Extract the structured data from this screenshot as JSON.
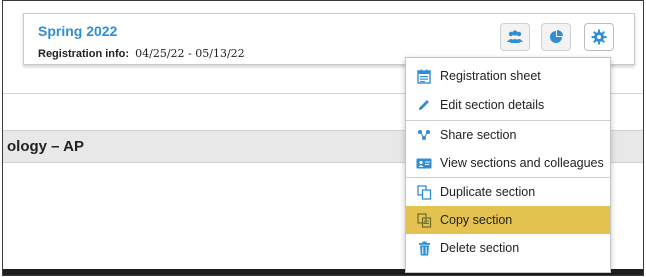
{
  "section": {
    "term": "Spring 2022",
    "registration_label": "Registration info:",
    "registration_dates": "04/25/22 - 05/13/22"
  },
  "toolbar": {
    "buttons": [
      {
        "icon": "people-icon"
      },
      {
        "icon": "pie-chart-icon"
      },
      {
        "icon": "gear-icon",
        "state": "active"
      }
    ]
  },
  "course": {
    "title": "ology – AP"
  },
  "menu": {
    "items": [
      {
        "label": "Registration sheet",
        "icon": "registration-sheet-icon"
      },
      {
        "label": "Edit section details",
        "icon": "pencil-icon"
      },
      {
        "label": "Share section",
        "icon": "share-icon"
      },
      {
        "label": "View sections and colleagues",
        "icon": "id-card-icon"
      },
      {
        "label": "Duplicate section",
        "icon": "duplicate-icon"
      },
      {
        "label": "Copy section",
        "icon": "copy-icon",
        "highlighted": true
      },
      {
        "label": "Delete section",
        "icon": "trash-icon"
      }
    ]
  },
  "colors": {
    "accent": "#2f8ed6",
    "highlight": "#e3c250",
    "footer": "#1f1f1f"
  }
}
